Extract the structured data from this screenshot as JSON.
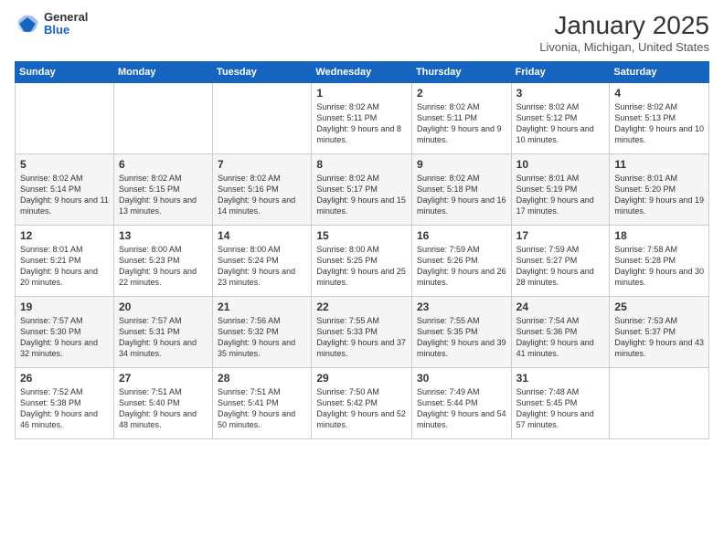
{
  "header": {
    "logo_general": "General",
    "logo_blue": "Blue",
    "month_title": "January 2025",
    "location": "Livonia, Michigan, United States"
  },
  "days_of_week": [
    "Sunday",
    "Monday",
    "Tuesday",
    "Wednesday",
    "Thursday",
    "Friday",
    "Saturday"
  ],
  "weeks": [
    [
      {
        "day": "",
        "content": ""
      },
      {
        "day": "",
        "content": ""
      },
      {
        "day": "",
        "content": ""
      },
      {
        "day": "1",
        "content": "Sunrise: 8:02 AM\nSunset: 5:11 PM\nDaylight: 9 hours and 8 minutes."
      },
      {
        "day": "2",
        "content": "Sunrise: 8:02 AM\nSunset: 5:11 PM\nDaylight: 9 hours and 9 minutes."
      },
      {
        "day": "3",
        "content": "Sunrise: 8:02 AM\nSunset: 5:12 PM\nDaylight: 9 hours and 10 minutes."
      },
      {
        "day": "4",
        "content": "Sunrise: 8:02 AM\nSunset: 5:13 PM\nDaylight: 9 hours and 10 minutes."
      }
    ],
    [
      {
        "day": "5",
        "content": "Sunrise: 8:02 AM\nSunset: 5:14 PM\nDaylight: 9 hours and 11 minutes."
      },
      {
        "day": "6",
        "content": "Sunrise: 8:02 AM\nSunset: 5:15 PM\nDaylight: 9 hours and 13 minutes."
      },
      {
        "day": "7",
        "content": "Sunrise: 8:02 AM\nSunset: 5:16 PM\nDaylight: 9 hours and 14 minutes."
      },
      {
        "day": "8",
        "content": "Sunrise: 8:02 AM\nSunset: 5:17 PM\nDaylight: 9 hours and 15 minutes."
      },
      {
        "day": "9",
        "content": "Sunrise: 8:02 AM\nSunset: 5:18 PM\nDaylight: 9 hours and 16 minutes."
      },
      {
        "day": "10",
        "content": "Sunrise: 8:01 AM\nSunset: 5:19 PM\nDaylight: 9 hours and 17 minutes."
      },
      {
        "day": "11",
        "content": "Sunrise: 8:01 AM\nSunset: 5:20 PM\nDaylight: 9 hours and 19 minutes."
      }
    ],
    [
      {
        "day": "12",
        "content": "Sunrise: 8:01 AM\nSunset: 5:21 PM\nDaylight: 9 hours and 20 minutes."
      },
      {
        "day": "13",
        "content": "Sunrise: 8:00 AM\nSunset: 5:23 PM\nDaylight: 9 hours and 22 minutes."
      },
      {
        "day": "14",
        "content": "Sunrise: 8:00 AM\nSunset: 5:24 PM\nDaylight: 9 hours and 23 minutes."
      },
      {
        "day": "15",
        "content": "Sunrise: 8:00 AM\nSunset: 5:25 PM\nDaylight: 9 hours and 25 minutes."
      },
      {
        "day": "16",
        "content": "Sunrise: 7:59 AM\nSunset: 5:26 PM\nDaylight: 9 hours and 26 minutes."
      },
      {
        "day": "17",
        "content": "Sunrise: 7:59 AM\nSunset: 5:27 PM\nDaylight: 9 hours and 28 minutes."
      },
      {
        "day": "18",
        "content": "Sunrise: 7:58 AM\nSunset: 5:28 PM\nDaylight: 9 hours and 30 minutes."
      }
    ],
    [
      {
        "day": "19",
        "content": "Sunrise: 7:57 AM\nSunset: 5:30 PM\nDaylight: 9 hours and 32 minutes."
      },
      {
        "day": "20",
        "content": "Sunrise: 7:57 AM\nSunset: 5:31 PM\nDaylight: 9 hours and 34 minutes."
      },
      {
        "day": "21",
        "content": "Sunrise: 7:56 AM\nSunset: 5:32 PM\nDaylight: 9 hours and 35 minutes."
      },
      {
        "day": "22",
        "content": "Sunrise: 7:55 AM\nSunset: 5:33 PM\nDaylight: 9 hours and 37 minutes."
      },
      {
        "day": "23",
        "content": "Sunrise: 7:55 AM\nSunset: 5:35 PM\nDaylight: 9 hours and 39 minutes."
      },
      {
        "day": "24",
        "content": "Sunrise: 7:54 AM\nSunset: 5:36 PM\nDaylight: 9 hours and 41 minutes."
      },
      {
        "day": "25",
        "content": "Sunrise: 7:53 AM\nSunset: 5:37 PM\nDaylight: 9 hours and 43 minutes."
      }
    ],
    [
      {
        "day": "26",
        "content": "Sunrise: 7:52 AM\nSunset: 5:38 PM\nDaylight: 9 hours and 46 minutes."
      },
      {
        "day": "27",
        "content": "Sunrise: 7:51 AM\nSunset: 5:40 PM\nDaylight: 9 hours and 48 minutes."
      },
      {
        "day": "28",
        "content": "Sunrise: 7:51 AM\nSunset: 5:41 PM\nDaylight: 9 hours and 50 minutes."
      },
      {
        "day": "29",
        "content": "Sunrise: 7:50 AM\nSunset: 5:42 PM\nDaylight: 9 hours and 52 minutes."
      },
      {
        "day": "30",
        "content": "Sunrise: 7:49 AM\nSunset: 5:44 PM\nDaylight: 9 hours and 54 minutes."
      },
      {
        "day": "31",
        "content": "Sunrise: 7:48 AM\nSunset: 5:45 PM\nDaylight: 9 hours and 57 minutes."
      },
      {
        "day": "",
        "content": ""
      }
    ]
  ]
}
